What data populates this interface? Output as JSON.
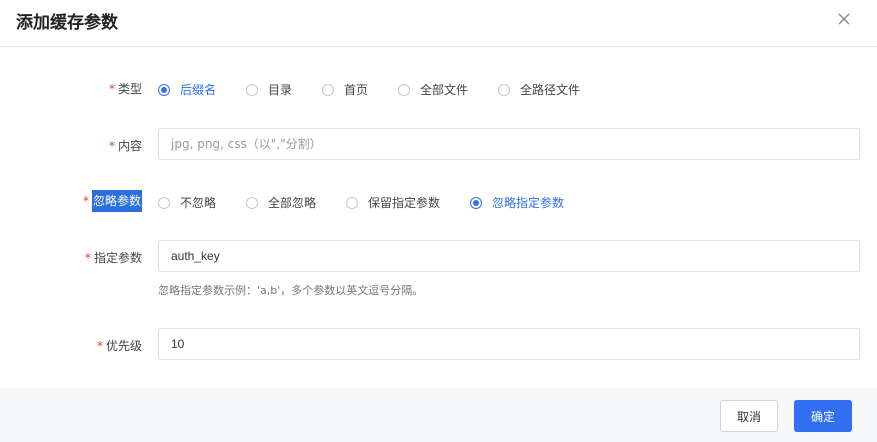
{
  "dialog": {
    "title": "添加缓存参数",
    "close_icon": "close-icon"
  },
  "form": {
    "required_mark": "*",
    "type": {
      "label": "类型",
      "options": [
        "后缀名",
        "目录",
        "首页",
        "全部文件",
        "全路径文件"
      ],
      "selected": "后缀名"
    },
    "content": {
      "label": "内容",
      "placeholder": "jpg, png, css（以\",\"分割）",
      "value": ""
    },
    "ignore_params": {
      "label": "忽略参数",
      "options": [
        "不忽略",
        "全部忽略",
        "保留指定参数",
        "忽略指定参数"
      ],
      "selected": "忽略指定参数"
    },
    "specified_params": {
      "label": "指定参数",
      "value": "auth_key",
      "hint": "忽略指定参数示例：'a,b'，多个参数以英文逗号分隔。"
    },
    "priority": {
      "label": "优先级",
      "value": "10"
    }
  },
  "footer": {
    "cancel_label": "取消",
    "ok_label": "确定"
  },
  "colors": {
    "accent": "#2f6ff0",
    "required": "#e4393c",
    "footer_bg": "#f6f7f9"
  }
}
